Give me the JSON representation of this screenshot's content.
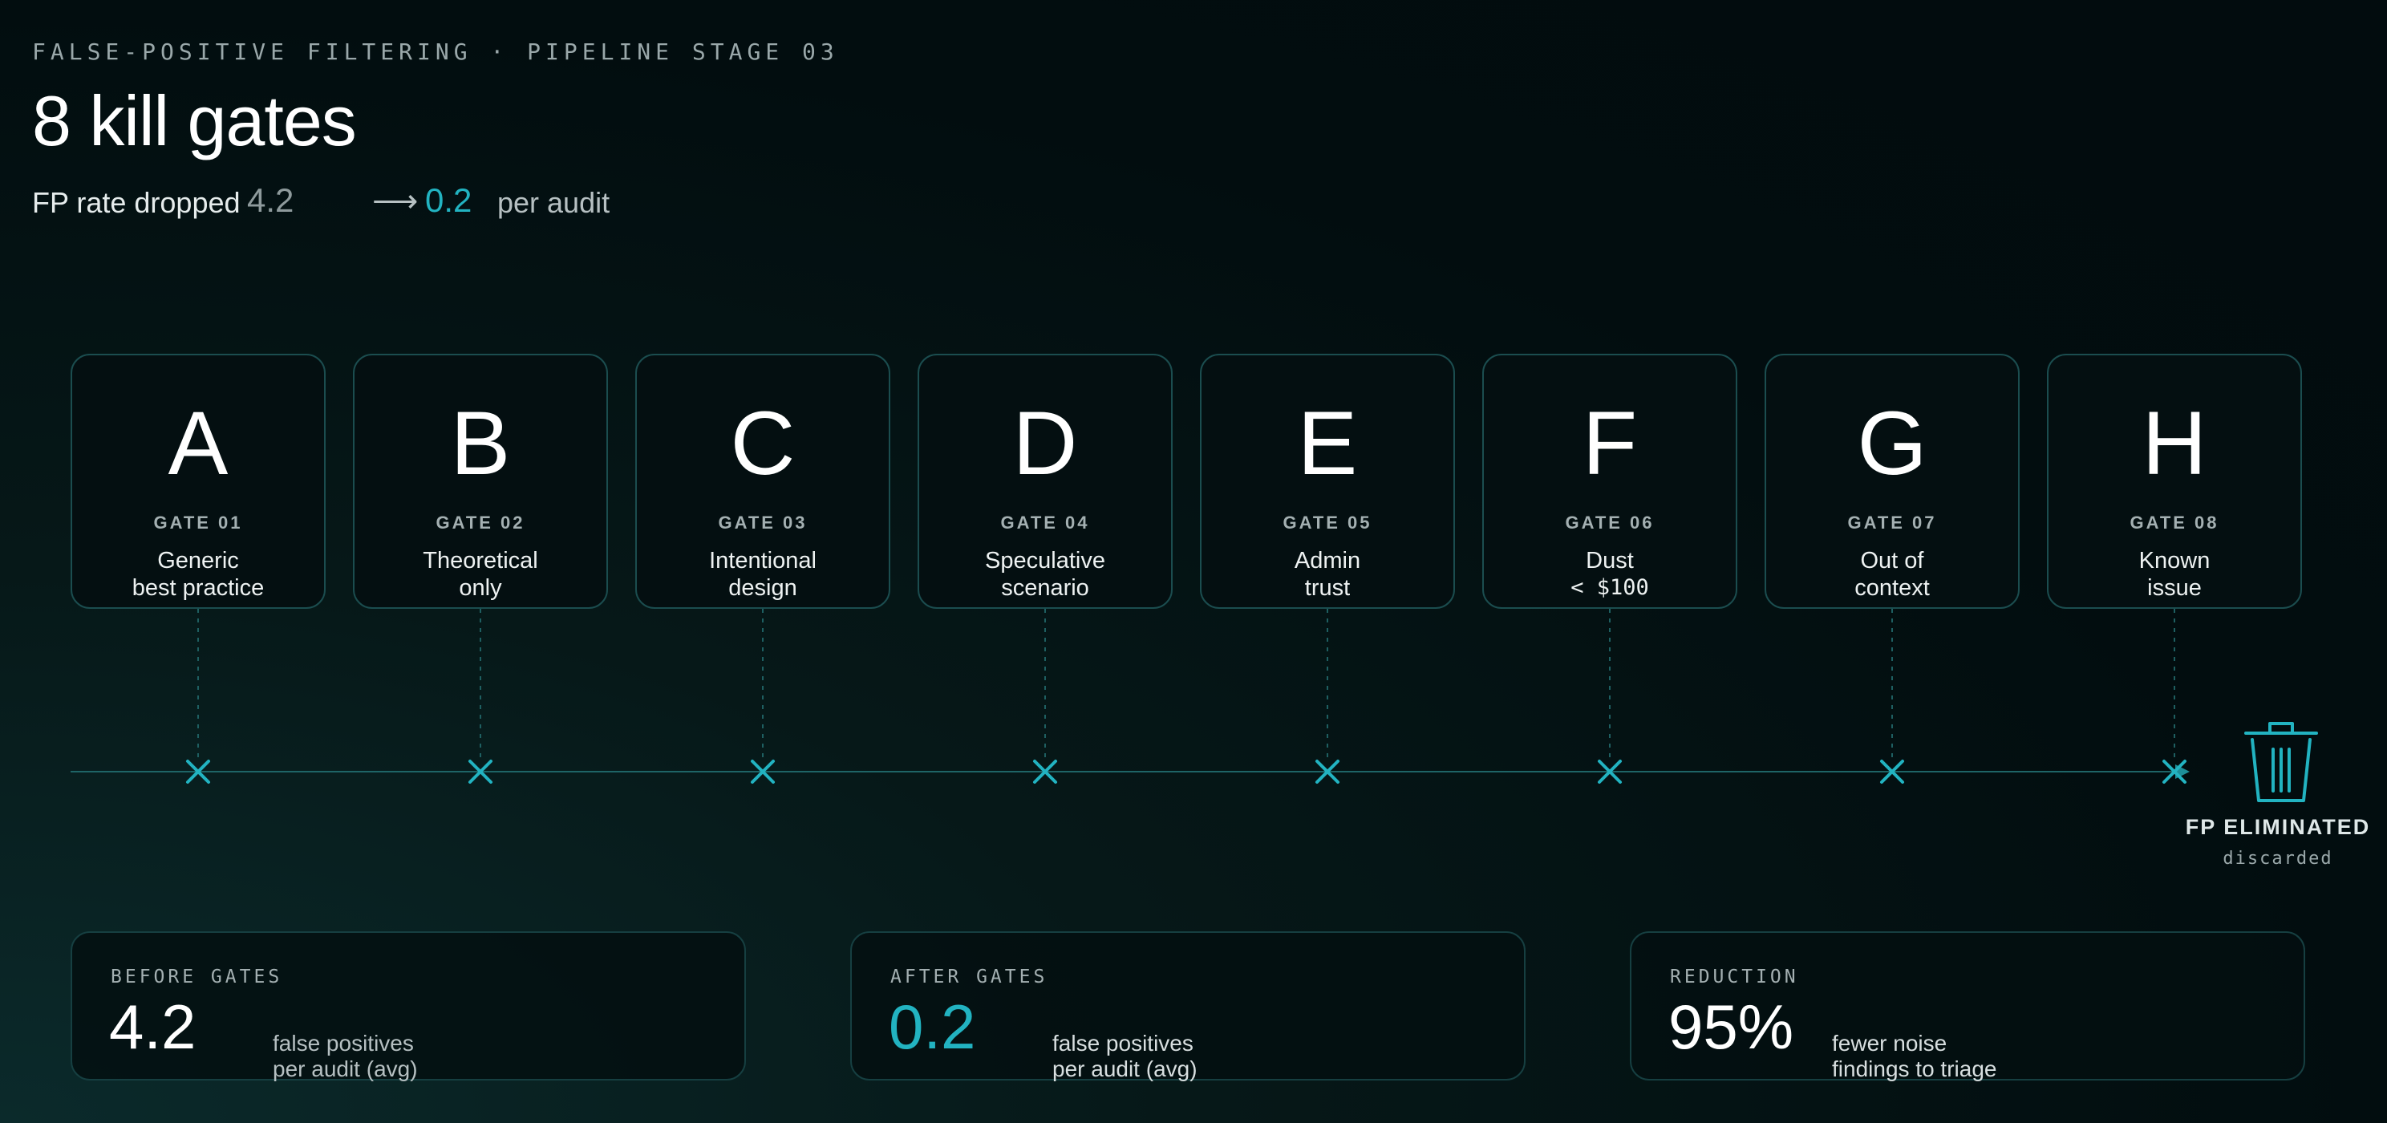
{
  "header": {
    "eyebrow": "FALSE-POSITIVE FILTERING · PIPELINE STAGE 03",
    "title": "8 kill gates",
    "sub_prefix": "FP rate dropped",
    "sub_from": "4.2",
    "sub_arrow": "⟶",
    "sub_to": "0.2",
    "sub_suffix": "per audit"
  },
  "gates": [
    {
      "letter": "A",
      "label": "GATE 01",
      "line1": "Generic",
      "line2": "best practice"
    },
    {
      "letter": "B",
      "label": "GATE 02",
      "line1": "Theoretical",
      "line2": "only"
    },
    {
      "letter": "C",
      "label": "GATE 03",
      "line1": "Intentional",
      "line2": "design"
    },
    {
      "letter": "D",
      "label": "GATE 04",
      "line1": "Speculative",
      "line2": "scenario"
    },
    {
      "letter": "E",
      "label": "GATE 05",
      "line1": "Admin",
      "line2": "trust"
    },
    {
      "letter": "F",
      "label": "GATE 06",
      "line1": "Dust",
      "line2": "< $100"
    },
    {
      "letter": "G",
      "label": "GATE 07",
      "line1": "Out of",
      "line2": "context"
    },
    {
      "letter": "H",
      "label": "GATE 08",
      "line1": "Known",
      "line2": "issue"
    }
  ],
  "sink": {
    "icon": "trash-icon",
    "title": "FP ELIMINATED",
    "subtitle": "discarded"
  },
  "stats": [
    {
      "label": "BEFORE GATES",
      "value": "4.2",
      "cap1": "false positives",
      "cap2": "per audit (avg)"
    },
    {
      "label": "AFTER GATES",
      "value": "0.2",
      "cap1": "false positives",
      "cap2": "per audit (avg)"
    },
    {
      "label": "REDUCTION",
      "value": "95%",
      "cap1": "fewer noise",
      "cap2": "findings to triage"
    }
  ],
  "colors": {
    "accent": "#22b3c1",
    "card_border": "#1b4d4f",
    "background": "#020d0f",
    "muted_text": "#9aa8aa"
  }
}
